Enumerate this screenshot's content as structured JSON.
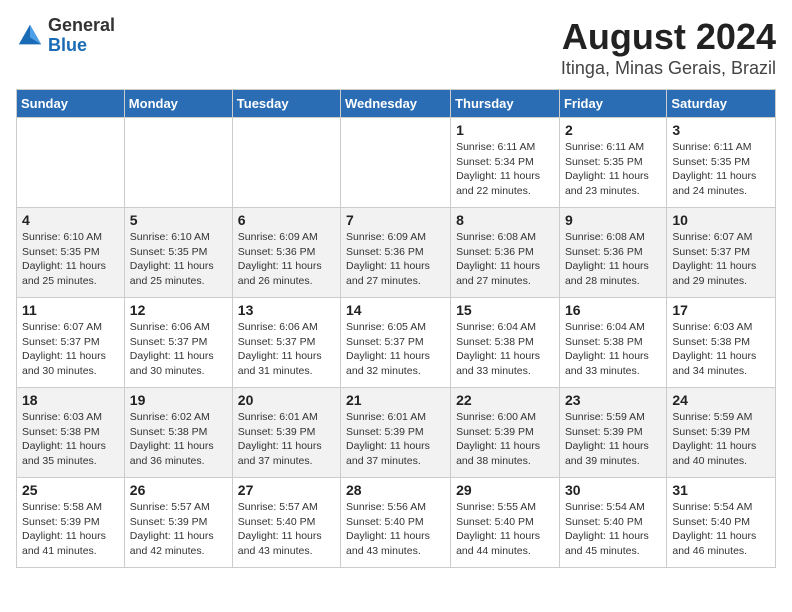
{
  "logo": {
    "line1": "General",
    "line2": "Blue"
  },
  "title": "August 2024",
  "subtitle": "Itinga, Minas Gerais, Brazil",
  "days_of_week": [
    "Sunday",
    "Monday",
    "Tuesday",
    "Wednesday",
    "Thursday",
    "Friday",
    "Saturday"
  ],
  "weeks": [
    [
      {
        "day": "",
        "empty": true
      },
      {
        "day": "",
        "empty": true
      },
      {
        "day": "",
        "empty": true
      },
      {
        "day": "",
        "empty": true
      },
      {
        "day": "1",
        "sunrise": "Sunrise: 6:11 AM",
        "sunset": "Sunset: 5:34 PM",
        "daylight": "Daylight: 11 hours and 22 minutes."
      },
      {
        "day": "2",
        "sunrise": "Sunrise: 6:11 AM",
        "sunset": "Sunset: 5:35 PM",
        "daylight": "Daylight: 11 hours and 23 minutes."
      },
      {
        "day": "3",
        "sunrise": "Sunrise: 6:11 AM",
        "sunset": "Sunset: 5:35 PM",
        "daylight": "Daylight: 11 hours and 24 minutes."
      }
    ],
    [
      {
        "day": "4",
        "sunrise": "Sunrise: 6:10 AM",
        "sunset": "Sunset: 5:35 PM",
        "daylight": "Daylight: 11 hours and 25 minutes."
      },
      {
        "day": "5",
        "sunrise": "Sunrise: 6:10 AM",
        "sunset": "Sunset: 5:35 PM",
        "daylight": "Daylight: 11 hours and 25 minutes."
      },
      {
        "day": "6",
        "sunrise": "Sunrise: 6:09 AM",
        "sunset": "Sunset: 5:36 PM",
        "daylight": "Daylight: 11 hours and 26 minutes."
      },
      {
        "day": "7",
        "sunrise": "Sunrise: 6:09 AM",
        "sunset": "Sunset: 5:36 PM",
        "daylight": "Daylight: 11 hours and 27 minutes."
      },
      {
        "day": "8",
        "sunrise": "Sunrise: 6:08 AM",
        "sunset": "Sunset: 5:36 PM",
        "daylight": "Daylight: 11 hours and 27 minutes."
      },
      {
        "day": "9",
        "sunrise": "Sunrise: 6:08 AM",
        "sunset": "Sunset: 5:36 PM",
        "daylight": "Daylight: 11 hours and 28 minutes."
      },
      {
        "day": "10",
        "sunrise": "Sunrise: 6:07 AM",
        "sunset": "Sunset: 5:37 PM",
        "daylight": "Daylight: 11 hours and 29 minutes."
      }
    ],
    [
      {
        "day": "11",
        "sunrise": "Sunrise: 6:07 AM",
        "sunset": "Sunset: 5:37 PM",
        "daylight": "Daylight: 11 hours and 30 minutes."
      },
      {
        "day": "12",
        "sunrise": "Sunrise: 6:06 AM",
        "sunset": "Sunset: 5:37 PM",
        "daylight": "Daylight: 11 hours and 30 minutes."
      },
      {
        "day": "13",
        "sunrise": "Sunrise: 6:06 AM",
        "sunset": "Sunset: 5:37 PM",
        "daylight": "Daylight: 11 hours and 31 minutes."
      },
      {
        "day": "14",
        "sunrise": "Sunrise: 6:05 AM",
        "sunset": "Sunset: 5:37 PM",
        "daylight": "Daylight: 11 hours and 32 minutes."
      },
      {
        "day": "15",
        "sunrise": "Sunrise: 6:04 AM",
        "sunset": "Sunset: 5:38 PM",
        "daylight": "Daylight: 11 hours and 33 minutes."
      },
      {
        "day": "16",
        "sunrise": "Sunrise: 6:04 AM",
        "sunset": "Sunset: 5:38 PM",
        "daylight": "Daylight: 11 hours and 33 minutes."
      },
      {
        "day": "17",
        "sunrise": "Sunrise: 6:03 AM",
        "sunset": "Sunset: 5:38 PM",
        "daylight": "Daylight: 11 hours and 34 minutes."
      }
    ],
    [
      {
        "day": "18",
        "sunrise": "Sunrise: 6:03 AM",
        "sunset": "Sunset: 5:38 PM",
        "daylight": "Daylight: 11 hours and 35 minutes."
      },
      {
        "day": "19",
        "sunrise": "Sunrise: 6:02 AM",
        "sunset": "Sunset: 5:38 PM",
        "daylight": "Daylight: 11 hours and 36 minutes."
      },
      {
        "day": "20",
        "sunrise": "Sunrise: 6:01 AM",
        "sunset": "Sunset: 5:39 PM",
        "daylight": "Daylight: 11 hours and 37 minutes."
      },
      {
        "day": "21",
        "sunrise": "Sunrise: 6:01 AM",
        "sunset": "Sunset: 5:39 PM",
        "daylight": "Daylight: 11 hours and 37 minutes."
      },
      {
        "day": "22",
        "sunrise": "Sunrise: 6:00 AM",
        "sunset": "Sunset: 5:39 PM",
        "daylight": "Daylight: 11 hours and 38 minutes."
      },
      {
        "day": "23",
        "sunrise": "Sunrise: 5:59 AM",
        "sunset": "Sunset: 5:39 PM",
        "daylight": "Daylight: 11 hours and 39 minutes."
      },
      {
        "day": "24",
        "sunrise": "Sunrise: 5:59 AM",
        "sunset": "Sunset: 5:39 PM",
        "daylight": "Daylight: 11 hours and 40 minutes."
      }
    ],
    [
      {
        "day": "25",
        "sunrise": "Sunrise: 5:58 AM",
        "sunset": "Sunset: 5:39 PM",
        "daylight": "Daylight: 11 hours and 41 minutes."
      },
      {
        "day": "26",
        "sunrise": "Sunrise: 5:57 AM",
        "sunset": "Sunset: 5:39 PM",
        "daylight": "Daylight: 11 hours and 42 minutes."
      },
      {
        "day": "27",
        "sunrise": "Sunrise: 5:57 AM",
        "sunset": "Sunset: 5:40 PM",
        "daylight": "Daylight: 11 hours and 43 minutes."
      },
      {
        "day": "28",
        "sunrise": "Sunrise: 5:56 AM",
        "sunset": "Sunset: 5:40 PM",
        "daylight": "Daylight: 11 hours and 43 minutes."
      },
      {
        "day": "29",
        "sunrise": "Sunrise: 5:55 AM",
        "sunset": "Sunset: 5:40 PM",
        "daylight": "Daylight: 11 hours and 44 minutes."
      },
      {
        "day": "30",
        "sunrise": "Sunrise: 5:54 AM",
        "sunset": "Sunset: 5:40 PM",
        "daylight": "Daylight: 11 hours and 45 minutes."
      },
      {
        "day": "31",
        "sunrise": "Sunrise: 5:54 AM",
        "sunset": "Sunset: 5:40 PM",
        "daylight": "Daylight: 11 hours and 46 minutes."
      }
    ]
  ]
}
